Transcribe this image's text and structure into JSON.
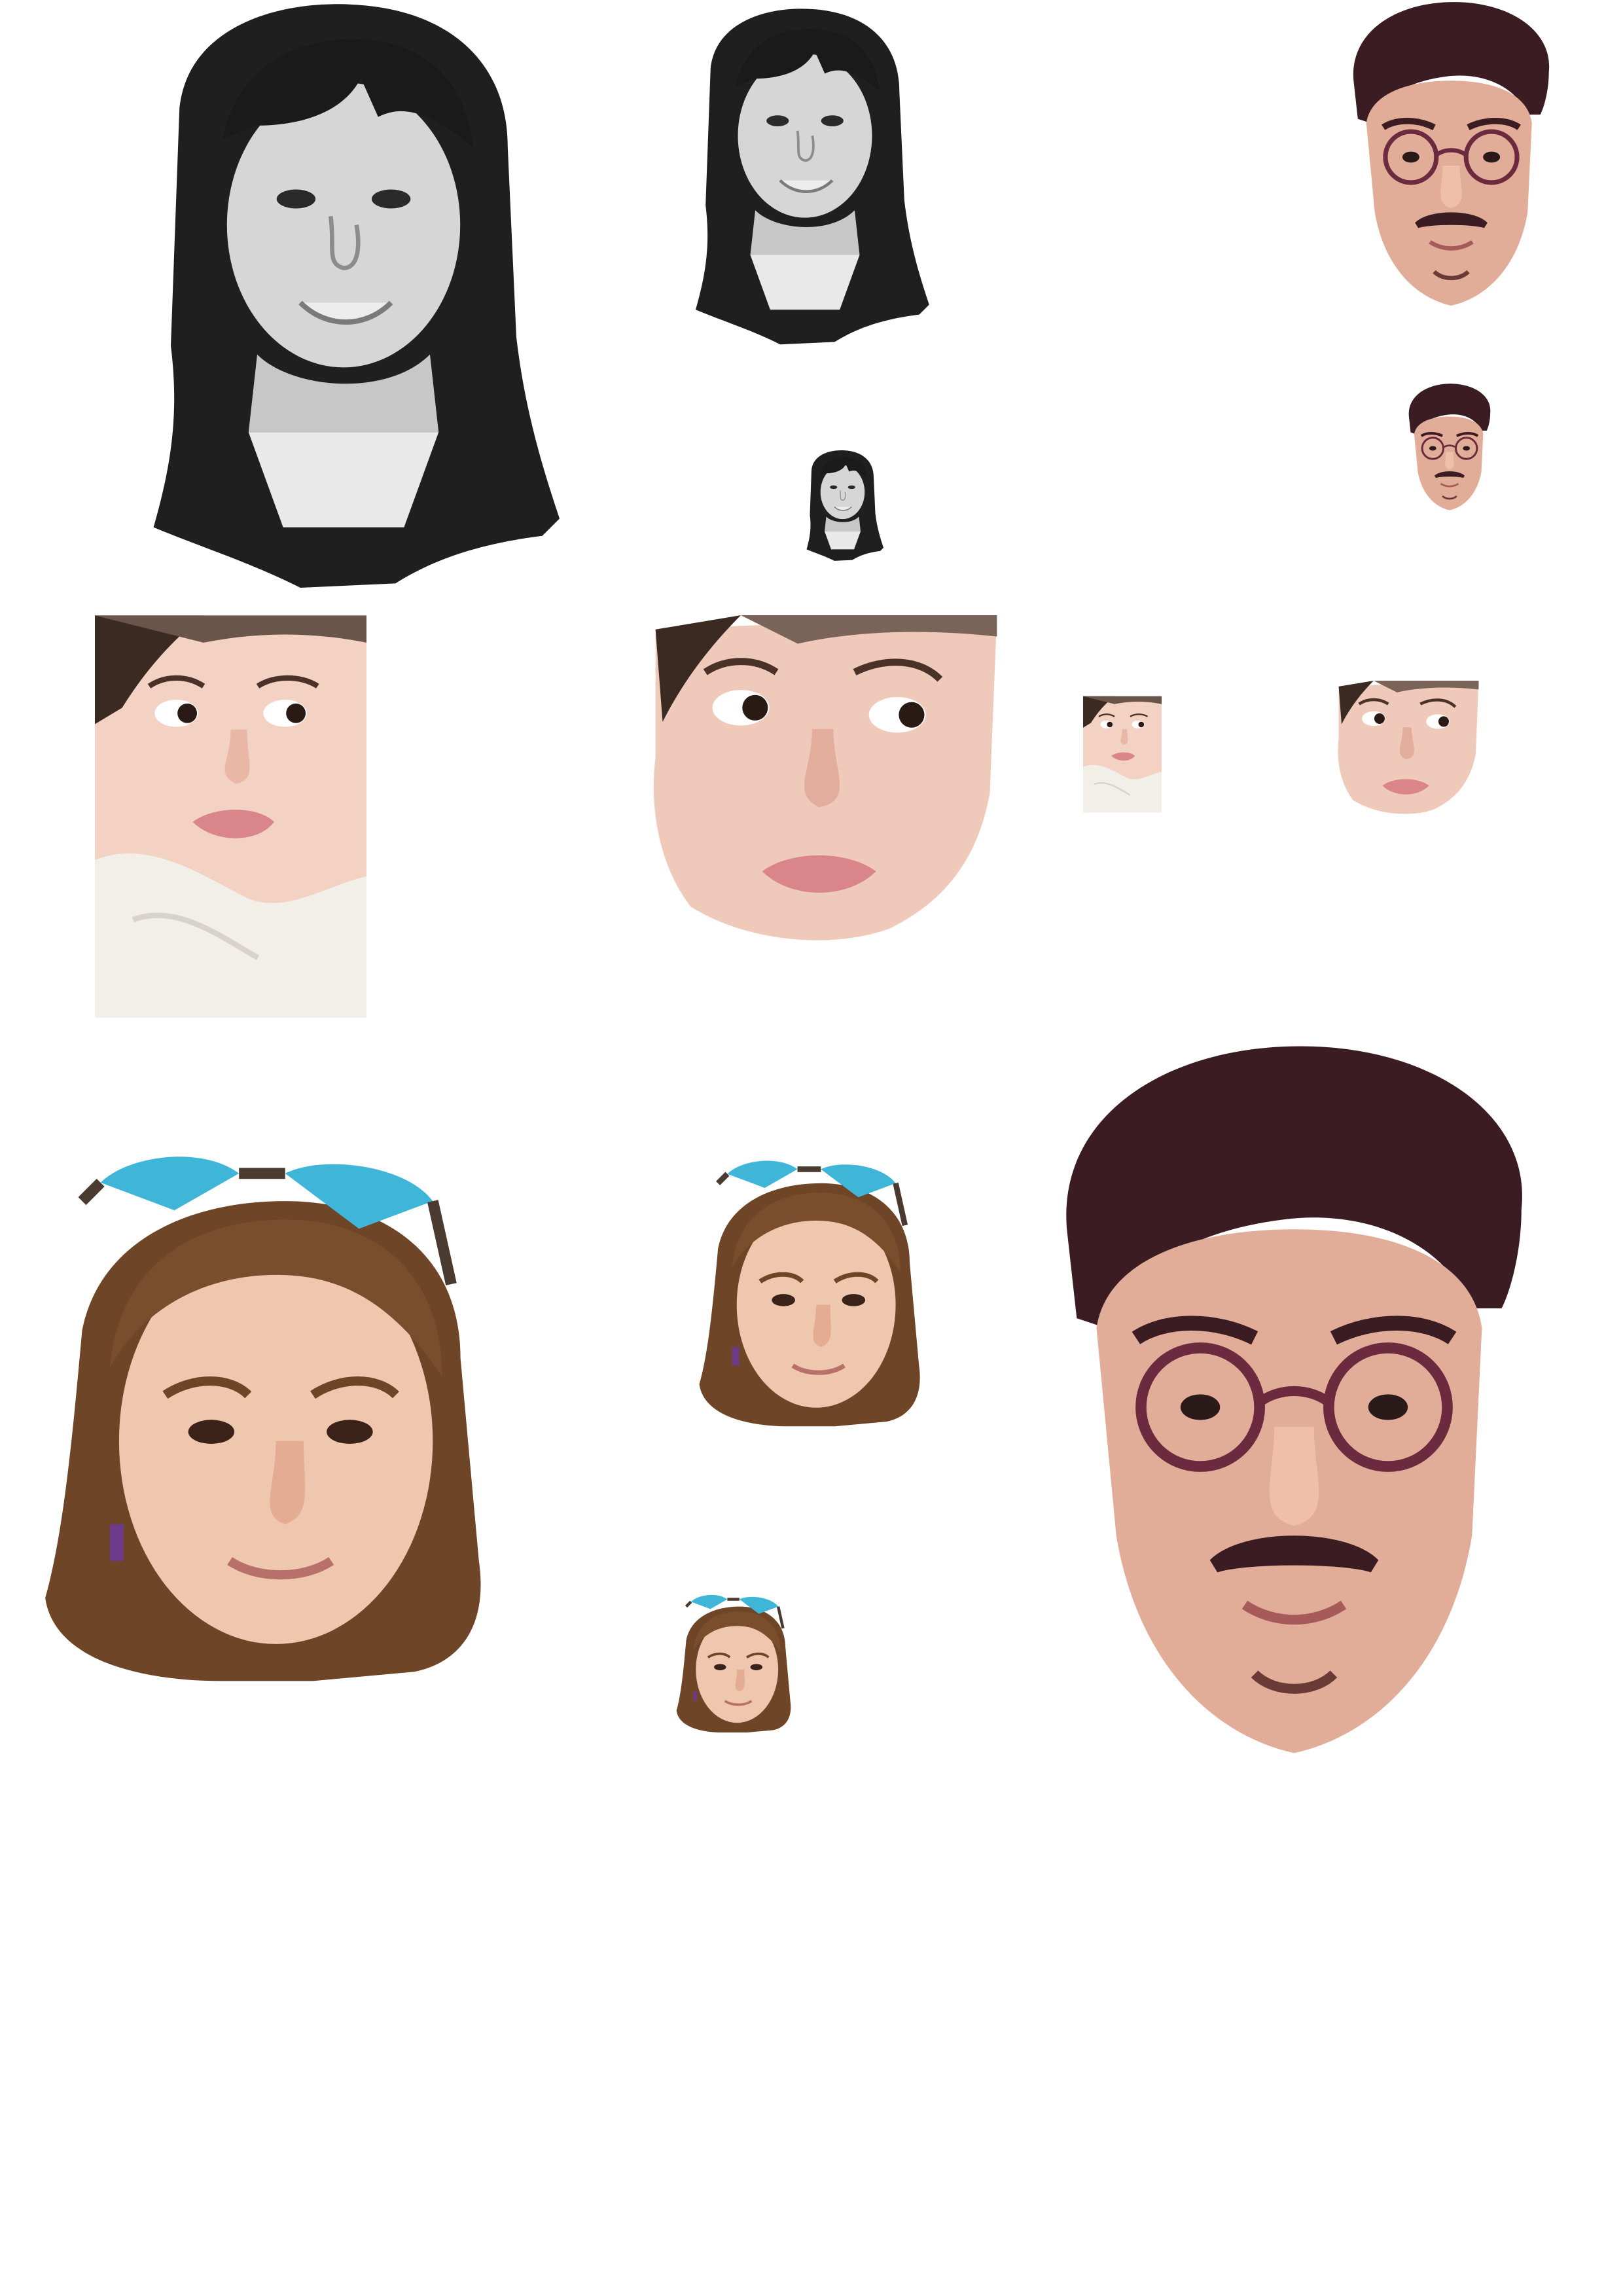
{
  "canvas": {
    "background": "#ffffff"
  },
  "cutouts": [
    {
      "id": "a1",
      "subject": "woman-grayscale",
      "style": "grayscale"
    },
    {
      "id": "a2",
      "subject": "woman-grayscale",
      "style": "grayscale"
    },
    {
      "id": "a3",
      "subject": "woman-grayscale",
      "style": "grayscale"
    },
    {
      "id": "b1",
      "subject": "man-glasses",
      "style": "color"
    },
    {
      "id": "b2",
      "subject": "man-glasses",
      "style": "color"
    },
    {
      "id": "b3",
      "subject": "man-glasses",
      "style": "color"
    },
    {
      "id": "c1",
      "subject": "woman-white-top",
      "style": "color"
    },
    {
      "id": "c2",
      "subject": "woman-white-top",
      "style": "color"
    },
    {
      "id": "c3",
      "subject": "woman-white-top",
      "style": "color"
    },
    {
      "id": "c4",
      "subject": "woman-white-top",
      "style": "color"
    },
    {
      "id": "d1",
      "subject": "woman-sunglasses",
      "style": "color"
    },
    {
      "id": "d2",
      "subject": "woman-sunglasses",
      "style": "color"
    },
    {
      "id": "d3",
      "subject": "woman-sunglasses",
      "style": "color"
    }
  ],
  "colors": {
    "gray_skin": "#d2d2d2",
    "gray_hair": "#1e1e1e",
    "tan_skin": "#e0a995",
    "dark_hair": "#3a1d20",
    "glasses_frame": "#6b2a3e",
    "asian_skin": "#ecc3b3",
    "white_top": "#f2efe8",
    "lips": "#d9858a",
    "fair_skin": "#efc6ae",
    "brown_hair": "#6e4527",
    "sunglasses": "#3fb6d8"
  }
}
